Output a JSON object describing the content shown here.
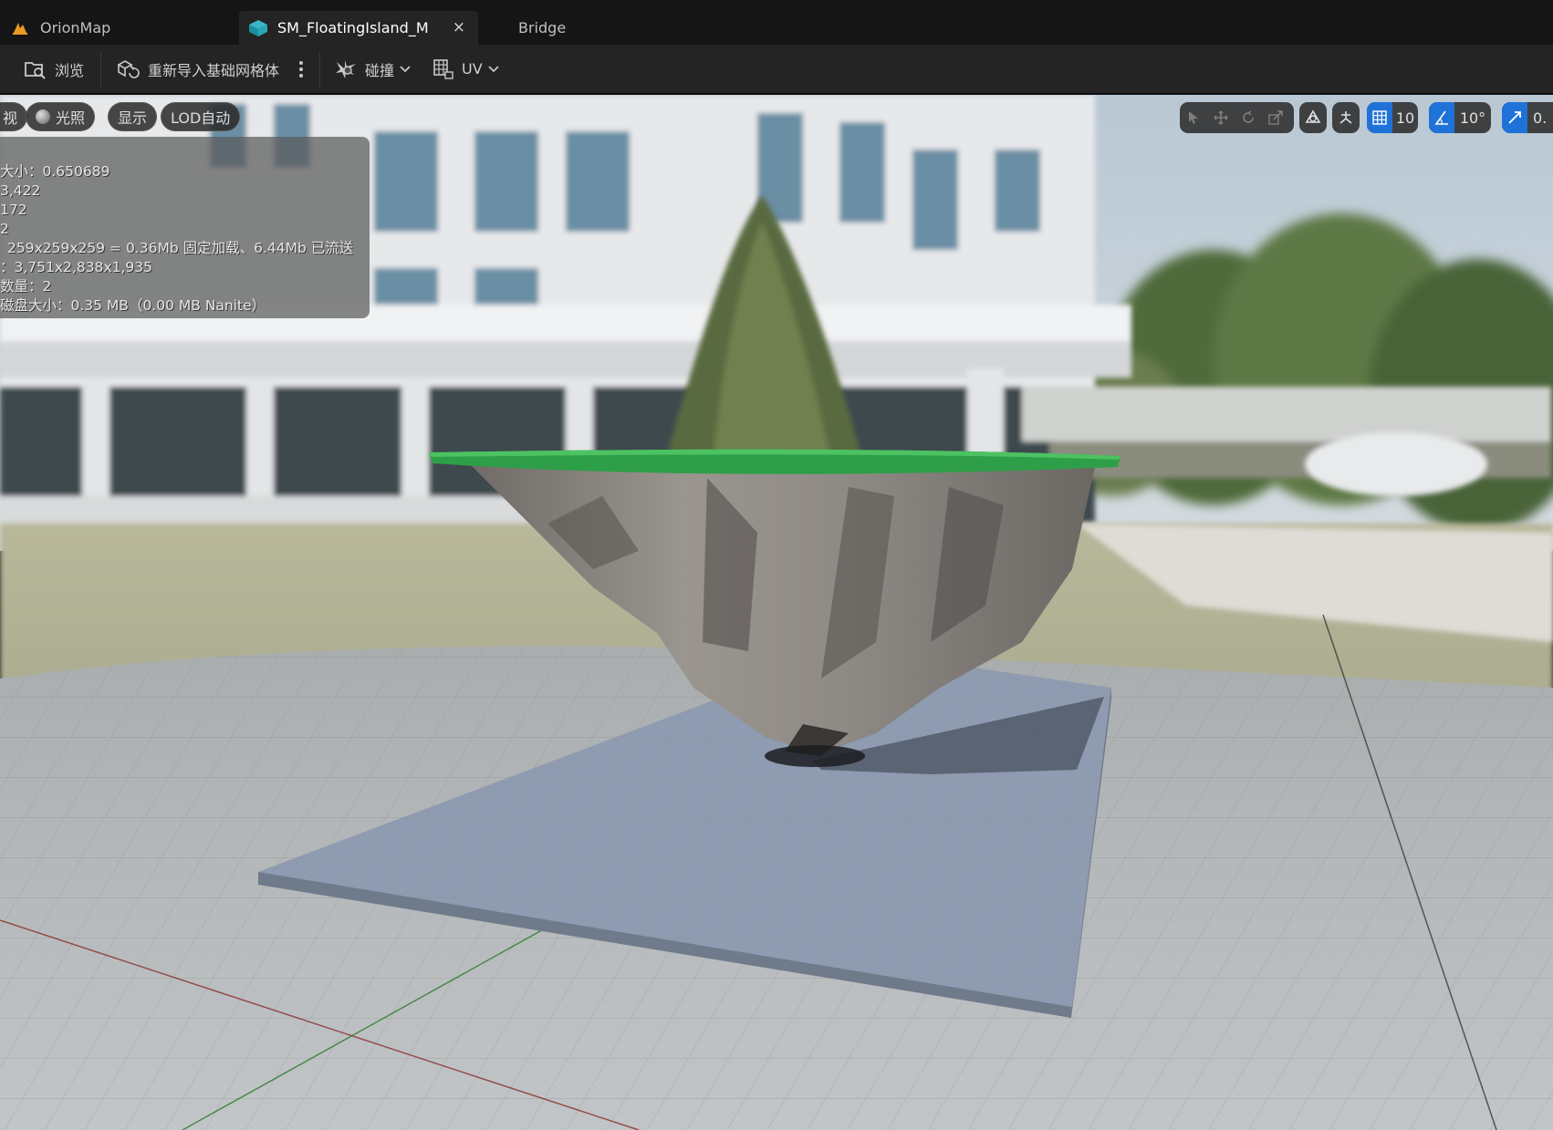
{
  "tabs": [
    {
      "label": "OrionMap",
      "icon": "unreal-warning-icon",
      "active": false
    },
    {
      "label": "SM_FloatingIsland_M",
      "icon": "static-mesh-icon",
      "active": true,
      "close": "×"
    },
    {
      "label": "Bridge",
      "active": false
    }
  ],
  "toolbar": {
    "browse": "浏览",
    "reimport": "重新导入基础网格体",
    "collision": "碰撞",
    "uv": "UV"
  },
  "viewport": {
    "lighting": "光照",
    "show": "显示",
    "lod": "LOD自动",
    "left_partial": "视",
    "grid_snap": "10",
    "rot_snap": "10°",
    "scale_snap": "0."
  },
  "stats": [
    "大小：0.650689",
    "3,422",
    "172",
    "2",
    "259x259x259 = 0.36Mb 固定加载、6.44Mb 已流送",
    "：3,751x2,838x1,935",
    "数量：2",
    "磁盘大小：0.35 MB（0.00 MB Nanite）"
  ],
  "colors": {
    "accent": "#1f72d8",
    "island_grass": "#2f9e48",
    "rock": "#8a8580"
  }
}
